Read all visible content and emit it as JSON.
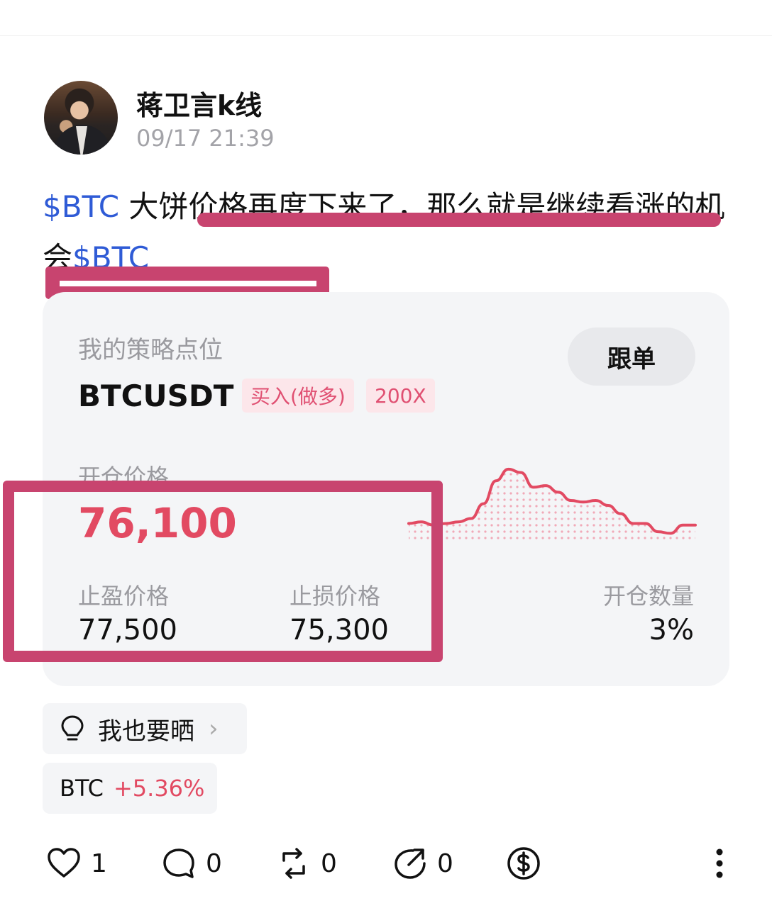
{
  "author": {
    "name": "蒋卫言k线",
    "time": "09/17 21:39"
  },
  "post": {
    "tag1": "$BTC",
    "text": " 大饼价格再度下来了，那么就是继续看涨的机会",
    "tag2": "$BTC"
  },
  "strategy": {
    "label": "我的策略点位",
    "follow_button": "跟单",
    "symbol": "BTCUSDT",
    "side": "买入(做多)",
    "leverage": "200X",
    "open_price_label": "开仓价格",
    "open_price": "76,100",
    "take_profit_label": "止盈价格",
    "take_profit": "77,500",
    "stop_loss_label": "止损价格",
    "stop_loss": "75,300",
    "quantity_label": "开仓数量",
    "quantity": "3%",
    "sparkline": [
      0.22,
      0.24,
      0.2,
      0.22,
      0.24,
      0.28,
      0.46,
      0.74,
      0.88,
      0.84,
      0.66,
      0.68,
      0.6,
      0.5,
      0.48,
      0.5,
      0.44,
      0.34,
      0.22,
      0.22,
      0.12,
      0.1,
      0.2,
      0.2
    ],
    "accent_color": "#e24a62"
  },
  "share_chip": {
    "label": "我也要晒",
    "icon": "lightbulb-icon"
  },
  "coin_chip": {
    "coin": "BTC",
    "change": "+5.36%"
  },
  "actions": {
    "likes": "1",
    "comments": "0",
    "reposts": "0",
    "shares": "0"
  },
  "annotation_color": "#c8446f"
}
